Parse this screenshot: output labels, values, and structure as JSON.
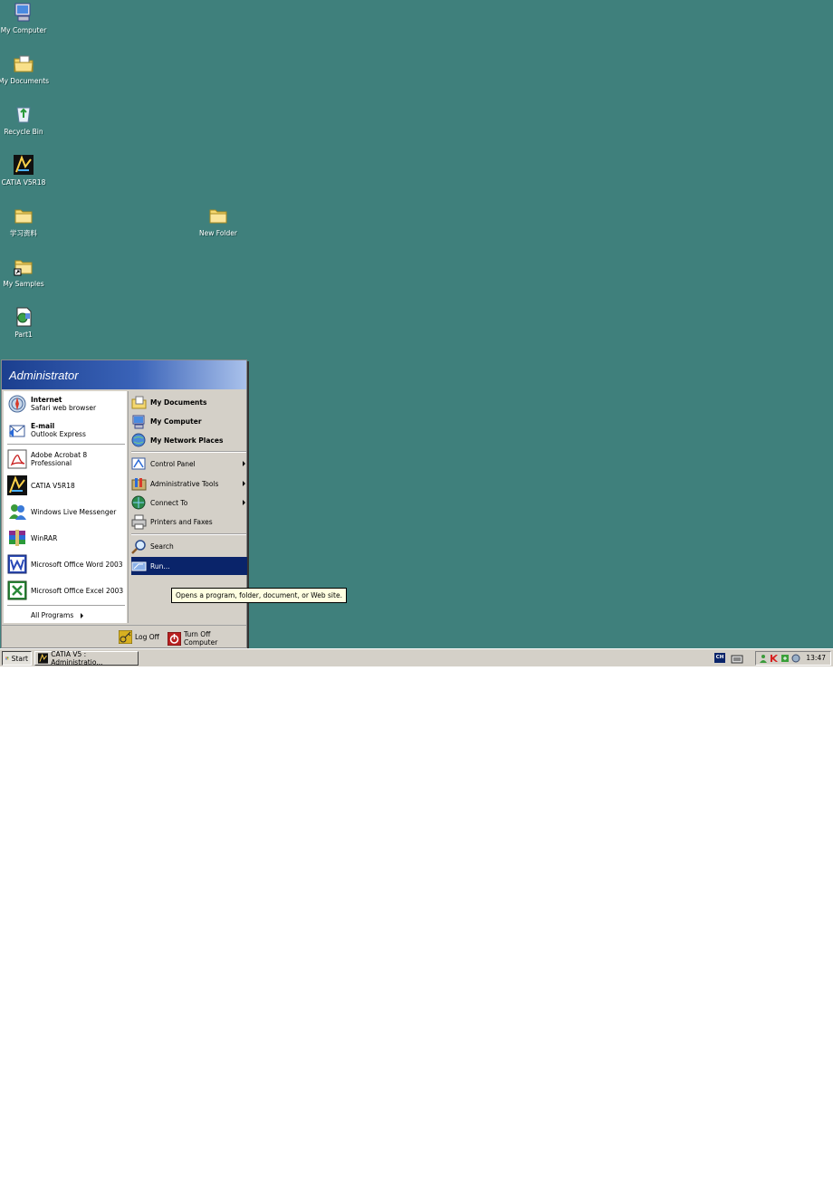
{
  "desktop": {
    "background_color": "#3f807c",
    "icons": [
      {
        "label": "My Computer",
        "icon": "my-computer-icon"
      },
      {
        "label": "My Documents",
        "icon": "my-documents-icon"
      },
      {
        "label": "Recycle Bin",
        "icon": "recycle-bin-icon"
      },
      {
        "label": "CATIA V5R18",
        "icon": "catia-icon"
      },
      {
        "label": "学习资料",
        "icon": "folder-icon"
      },
      {
        "label": "New Folder",
        "icon": "folder-icon"
      },
      {
        "label": "My Samples",
        "icon": "folder-shortcut-icon"
      },
      {
        "label": "Part1",
        "icon": "catia-part-icon"
      }
    ]
  },
  "start_menu": {
    "user": "Administrator",
    "pinned": [
      {
        "title": "Internet",
        "subtitle": "Safari web browser",
        "icon": "internet-icon"
      },
      {
        "title": "E-mail",
        "subtitle": "Outlook Express",
        "icon": "email-icon"
      }
    ],
    "recent": [
      {
        "label_line1": "Adobe Acrobat 8",
        "label_line2": "Professional",
        "icon": "acrobat-icon"
      },
      {
        "label": "CATIA V5R18",
        "icon": "catia-icon"
      },
      {
        "label": "Windows Live Messenger",
        "icon": "messenger-icon"
      },
      {
        "label": "WinRAR",
        "icon": "winrar-icon"
      },
      {
        "label": "Microsoft Office Word 2003",
        "icon": "word-icon"
      },
      {
        "label": "Microsoft Office Excel 2003",
        "icon": "excel-icon"
      }
    ],
    "all_programs": "All Programs",
    "places": [
      {
        "label": "My Documents",
        "icon": "my-documents-icon"
      },
      {
        "label": "My Computer",
        "icon": "my-computer-icon"
      },
      {
        "label": "My Network Places",
        "icon": "network-places-icon"
      }
    ],
    "settings": [
      {
        "label": "Control Panel",
        "icon": "control-panel-icon",
        "submenu": true
      },
      {
        "label": "Administrative Tools",
        "icon": "admin-tools-icon",
        "submenu": true
      },
      {
        "label": "Connect To",
        "icon": "connect-to-icon",
        "submenu": true
      },
      {
        "label": "Printers and Faxes",
        "icon": "printer-icon",
        "submenu": false
      }
    ],
    "tools": [
      {
        "label": "Search",
        "icon": "search-icon",
        "selected": false
      },
      {
        "label": "Run...",
        "icon": "run-icon",
        "selected": true
      }
    ],
    "footer": {
      "log_off": "Log Off",
      "turn_off": "Turn Off Computer"
    },
    "selection_color": "#0a246a"
  },
  "tooltip": {
    "text": "Opens a program, folder, document, or Web site."
  },
  "taskbar": {
    "start_label": "Start",
    "task_label": "CATIA V5 : Administratio...",
    "language": "CH",
    "clock": "13:47"
  }
}
